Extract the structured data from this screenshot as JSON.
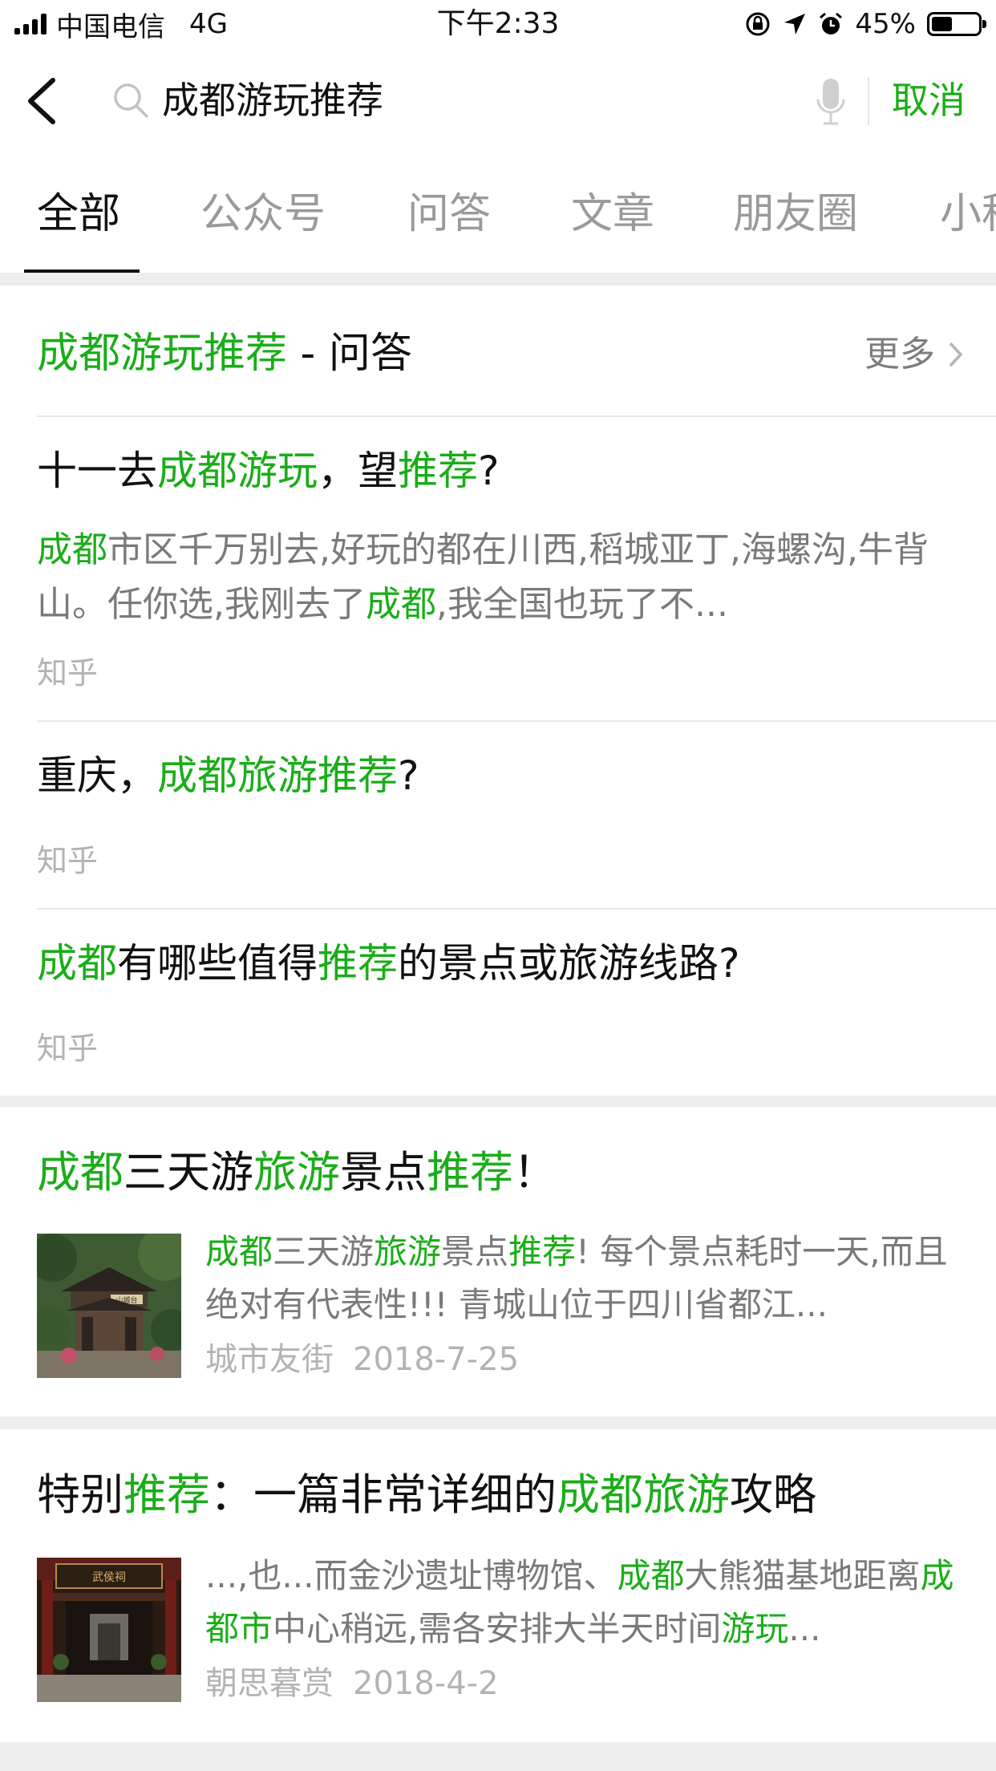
{
  "status": {
    "carrier": "中国电信",
    "network": "4G",
    "time": "下午2:33",
    "battery": "45%",
    "battery_level": 0.45
  },
  "search": {
    "query": "成都游玩推荐",
    "cancel": "取消"
  },
  "tabs": [
    "全部",
    "公众号",
    "问答",
    "文章",
    "朋友圈",
    "小程"
  ],
  "qa_section": {
    "header_keyword": "成都游玩推荐",
    "header_suffix": " - 问答",
    "more": "更多",
    "items": [
      {
        "title": [
          {
            "t": "十一去",
            "h": false
          },
          {
            "t": "成都游玩",
            "h": true
          },
          {
            "t": "，望",
            "h": false
          },
          {
            "t": "推荐",
            "h": true
          },
          {
            "t": "?",
            "h": false
          }
        ],
        "snippet": [
          {
            "t": "成都",
            "h": true
          },
          {
            "t": "市区千万别去,好玩的都在川西,稻城亚丁,海螺沟,牛背山。任你选,我刚去了",
            "h": false
          },
          {
            "t": "成都",
            "h": true
          },
          {
            "t": ",我全国也玩了不...",
            "h": false
          }
        ],
        "source": "知乎"
      },
      {
        "title": [
          {
            "t": "重庆，",
            "h": false
          },
          {
            "t": "成都旅游推荐",
            "h": true
          },
          {
            "t": "?",
            "h": false
          }
        ],
        "source": "知乎"
      },
      {
        "title": [
          {
            "t": "成都",
            "h": true
          },
          {
            "t": "有哪些值得",
            "h": false
          },
          {
            "t": "推荐",
            "h": true
          },
          {
            "t": "的景点或旅游线路?",
            "h": false
          }
        ],
        "source": "知乎"
      }
    ]
  },
  "articles": [
    {
      "title": [
        {
          "t": "成都",
          "h": true
        },
        {
          "t": "三天游",
          "h": false
        },
        {
          "t": "旅游",
          "h": true
        },
        {
          "t": "景点",
          "h": false
        },
        {
          "t": "推荐",
          "h": true
        },
        {
          "t": "！",
          "h": false
        }
      ],
      "snippet": [
        {
          "t": "成都",
          "h": true
        },
        {
          "t": "三天游",
          "h": false
        },
        {
          "t": "旅游",
          "h": true
        },
        {
          "t": "景点",
          "h": false
        },
        {
          "t": "推荐",
          "h": true
        },
        {
          "t": "! 每个景点耗时一天,而且绝对有代表性!!! 青城山位于四川省都江...",
          "h": false
        }
      ],
      "author": "城市友街",
      "date": "2018-7-25"
    },
    {
      "title": [
        {
          "t": "特别",
          "h": false
        },
        {
          "t": "推荐",
          "h": true
        },
        {
          "t": "：一篇非常详细的",
          "h": false
        },
        {
          "t": "成都旅游",
          "h": true
        },
        {
          "t": "攻略",
          "h": false
        }
      ],
      "snippet": [
        {
          "t": "...,也...而金沙遗址博物馆、",
          "h": false
        },
        {
          "t": "成都",
          "h": true
        },
        {
          "t": "大熊猫基地距离",
          "h": false
        },
        {
          "t": "成都市",
          "h": true
        },
        {
          "t": "中心稍远,需各安排大半天时间",
          "h": false
        },
        {
          "t": "游玩",
          "h": true
        },
        {
          "t": "...",
          "h": false
        }
      ],
      "author": "朝思暮赏",
      "date": "2018-4-2"
    }
  ],
  "thumb_signs": [
    "山城台",
    "武侯祠"
  ],
  "colors": {
    "accent": "#1aad19",
    "bg": "#ededed",
    "muted": "#7a7a7a",
    "faint": "#b3b3b3"
  },
  "icons": [
    "signal-icon",
    "lock-rotation-icon",
    "location-icon",
    "alarm-icon",
    "battery-icon",
    "back-icon",
    "search-icon",
    "microphone-icon",
    "chevron-right-icon"
  ]
}
